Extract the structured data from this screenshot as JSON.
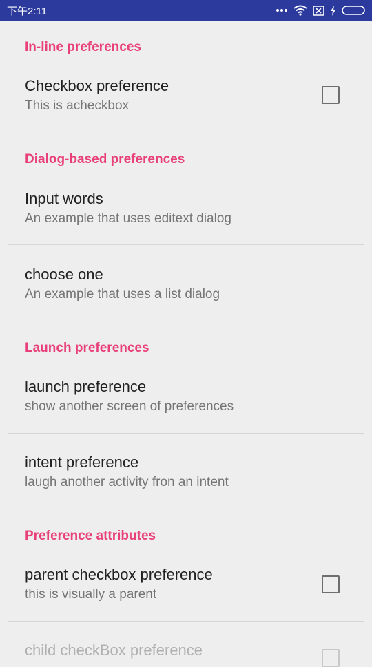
{
  "status_bar": {
    "time": "下午2:11",
    "icons": [
      "more-dots-icon",
      "wifi-icon",
      "sim-x-icon",
      "charging-bolt-icon",
      "battery-icon"
    ]
  },
  "colors": {
    "status_bar": "#2c3a9e",
    "accent": "#e8407a",
    "background": "#eeeeee"
  },
  "categories": [
    {
      "label": "In-line preferences"
    },
    {
      "label": "Dialog-based preferences"
    },
    {
      "label": "Launch preferences"
    },
    {
      "label": "Preference attributes"
    }
  ],
  "preferences": [
    {
      "title": "Checkbox preference",
      "summary": "This is acheckbox",
      "checked": false
    },
    {
      "title": "Input words",
      "summary": "An example that uses editext dialog"
    },
    {
      "title": "choose one",
      "summary": "An example that uses a list dialog"
    },
    {
      "title": "launch preference",
      "summary": "show another screen of preferences"
    },
    {
      "title": "intent preference",
      "summary": "laugh another activity fron an intent"
    },
    {
      "title": "parent checkbox preference",
      "summary": "this is visually a parent",
      "checked": false
    },
    {
      "title": "child checkBox preference",
      "summary": "",
      "checked": false,
      "enabled": false
    }
  ]
}
